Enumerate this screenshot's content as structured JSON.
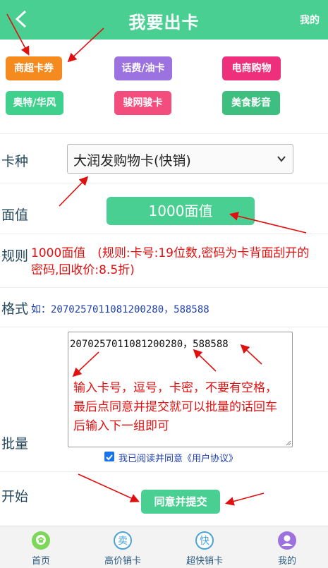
{
  "header": {
    "title": "我要出卡",
    "mine": "我的"
  },
  "categories": [
    {
      "label": "商超卡券",
      "color": "#f58a1e"
    },
    {
      "label": "话费/油卡",
      "color": "#9b72e0"
    },
    {
      "label": "电商购物",
      "color": "#ee2f7c"
    },
    {
      "label": "奥特/华风",
      "color": "#3fd08d"
    },
    {
      "label": "骏网骏卡",
      "color": "#f24d7c"
    },
    {
      "label": "美食影音",
      "color": "#3fbf7f"
    }
  ],
  "form": {
    "card_type_label": "卡种",
    "card_type_value": "大润发购物卡(快销)",
    "face_value_label": "面值",
    "face_value_button": "1000面值",
    "rule_label": "规则",
    "rule_text": "1000面值　(规则:卡号:19位数,密码为卡背面刮开的密码,回收价:8.5折)",
    "format_label": "格式",
    "format_text": "如：2070257011081200280，588588",
    "batch_label": "批量",
    "batch_value": "2070257011081200280，588588",
    "batch_hint": "输入卡号，逗号，卡密，不要有空格，最后点同意并提交就可以批量的话回车后输入下一组即可",
    "agree_text": "我已阅读并同意《用户协议》",
    "agree_checked": true,
    "start_label": "开始",
    "submit_label": "同意并提交"
  },
  "tabbar": [
    {
      "label": "首页",
      "icon": "home-icon"
    },
    {
      "label": "高价销卡",
      "icon": "sell-icon",
      "glyph": "卖"
    },
    {
      "label": "超快销卡",
      "icon": "fast-icon",
      "glyph": "快"
    },
    {
      "label": "我的",
      "icon": "user-icon"
    }
  ],
  "colors": {
    "accent": "#48cf91",
    "annotation": "#e01010",
    "link": "#1e3fb0"
  }
}
